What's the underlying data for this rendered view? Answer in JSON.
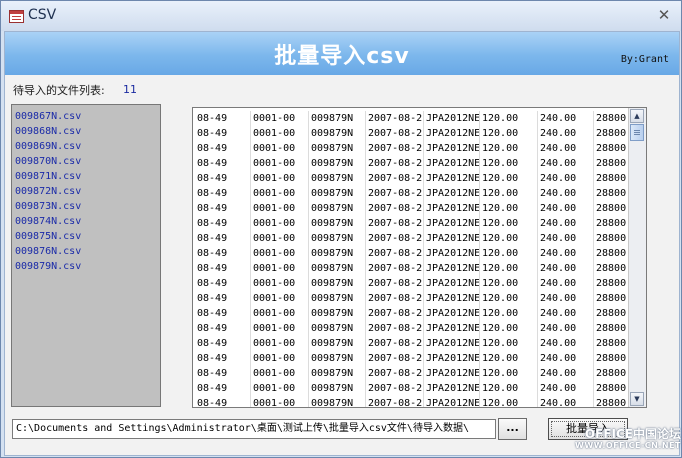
{
  "window": {
    "title": "CSV",
    "close_glyph": "✕"
  },
  "banner": {
    "title": "批量导入csv",
    "author": "By:Grant"
  },
  "file_list": {
    "count_label": "待导入的文件列表:",
    "count": "11",
    "items": [
      "009867N.csv",
      "009868N.csv",
      "009869N.csv",
      "009870N.csv",
      "009871N.csv",
      "009872N.csv",
      "009873N.csv",
      "009874N.csv",
      "009875N.csv",
      "009876N.csv",
      "009879N.csv"
    ]
  },
  "preview_grid": {
    "row_template": [
      "08-49",
      "0001-00",
      "009879N",
      "2007-08-2",
      "JPA2012NE",
      "120.00",
      "240.00",
      "28800"
    ],
    "visible_row_count": 20
  },
  "footer": {
    "path_value": "C:\\Documents and Settings\\Administrator\\桌面\\测试上传\\批量导入csv文件\\待导入数据\\",
    "browse_label": "...",
    "import_label": "批量导入"
  },
  "watermark": {
    "line1": "OFFICE中国论坛",
    "line2": "WWW.OFFICE-CN.NET"
  },
  "icons": {
    "app": "access-form-icon",
    "close": "close-icon",
    "scroll_up": "scroll-up-arrow-icon",
    "scroll_down": "scroll-down-arrow-icon"
  }
}
